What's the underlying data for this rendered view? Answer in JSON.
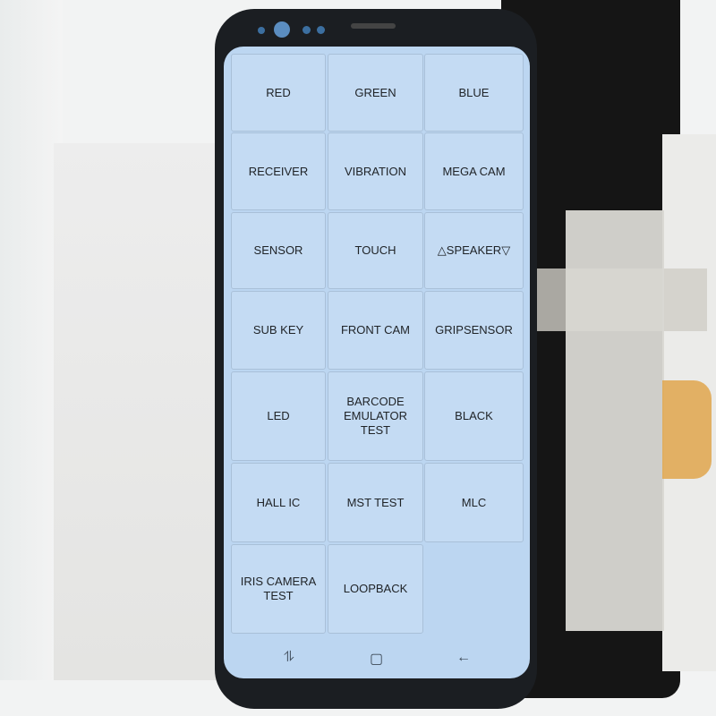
{
  "menu": {
    "items": [
      {
        "label": "RED"
      },
      {
        "label": "GREEN"
      },
      {
        "label": "BLUE"
      },
      {
        "label": "RECEIVER"
      },
      {
        "label": "VIBRATION"
      },
      {
        "label": "MEGA CAM"
      },
      {
        "label": "SENSOR"
      },
      {
        "label": "TOUCH"
      },
      {
        "label": "△SPEAKER▽"
      },
      {
        "label": "SUB KEY"
      },
      {
        "label": "FRONT CAM"
      },
      {
        "label": "GRIPSENSOR"
      },
      {
        "label": "LED"
      },
      {
        "label": "BARCODE EMULATOR TEST"
      },
      {
        "label": "BLACK"
      },
      {
        "label": "HALL IC"
      },
      {
        "label": "MST TEST"
      },
      {
        "label": "MLC"
      },
      {
        "label": "IRIS CAMERA TEST"
      },
      {
        "label": "LOOPBACK"
      }
    ]
  },
  "navbar": {
    "recents": "⥮",
    "home": "▢",
    "back": "←"
  },
  "colors": {
    "screen": "#bcd6f1",
    "cell": "#c4dbf3",
    "phone": "#1b1e22"
  }
}
